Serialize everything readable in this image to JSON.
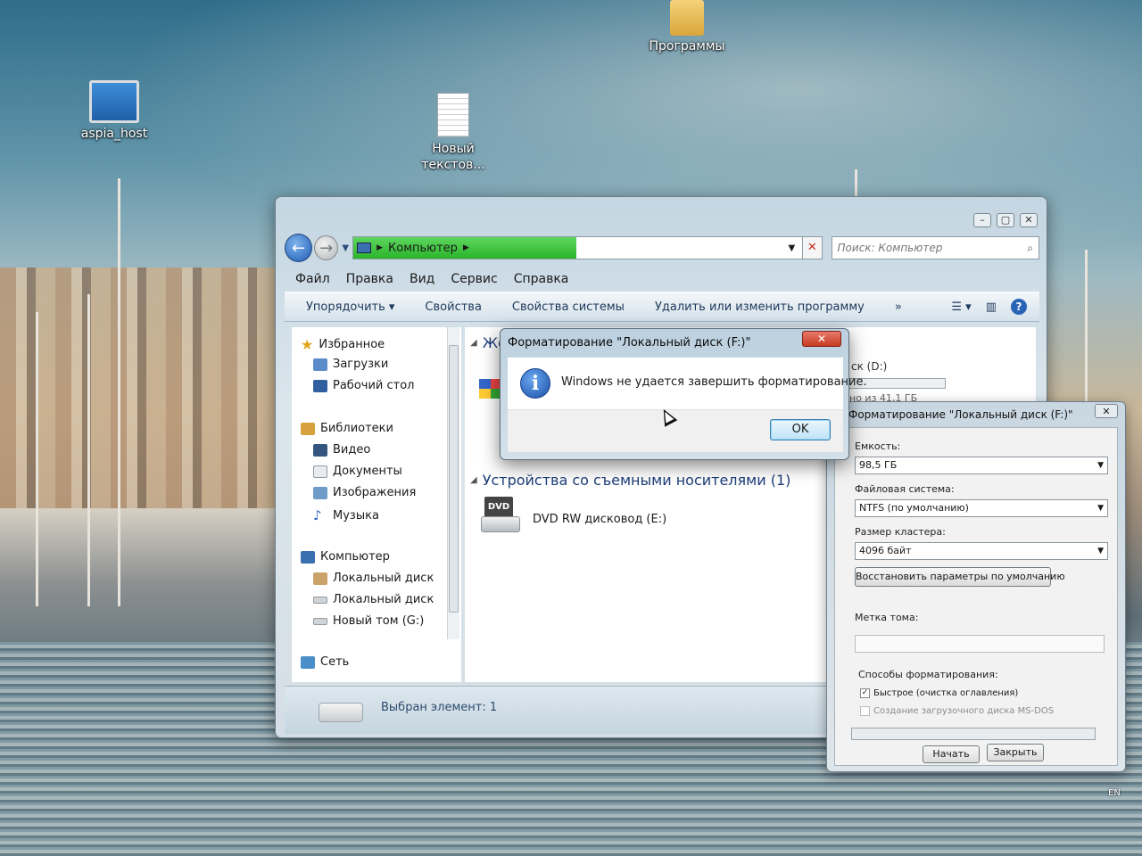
{
  "desktop": {
    "icons": [
      {
        "label": "Программы"
      },
      {
        "label": "aspia_host"
      },
      {
        "label": "Новый текстов..."
      }
    ],
    "tray_lang": "EN"
  },
  "explorer": {
    "address_crumbs": [
      "Компьютер"
    ],
    "search_placeholder": "Поиск: Компьютер",
    "menu": [
      "Файл",
      "Правка",
      "Вид",
      "Сервис",
      "Справка"
    ],
    "commands": [
      "Упорядочить ▾",
      "Свойства",
      "Свойства системы",
      "Удалить или изменить программу",
      "»"
    ],
    "nav": {
      "favorites": "Избранное",
      "favorites_items": [
        "Загрузки",
        "Рабочий стол"
      ],
      "libraries": "Библиотеки",
      "libraries_items": [
        "Видео",
        "Документы",
        "Изображения",
        "Музыка"
      ],
      "computer": "Компьютер",
      "computer_items": [
        "Локальный диск",
        "Локальный диск",
        "Новый том (G:)"
      ],
      "network": "Сеть"
    },
    "groups": {
      "hard_disks_partial": "Же",
      "removable": "Устройства со съемными носителями (1)"
    },
    "devices": [
      {
        "label": "DVD RW дисковод (E:)",
        "icon": "dvd-drive-icon"
      }
    ],
    "partial_drive_label": "ск (D:)",
    "partial_drive_free": "но из 41,1 ГБ",
    "status": "Выбран элемент: 1"
  },
  "format_dialog": {
    "title": "Форматирование \"Локальный диск (F:)\"",
    "capacity_label": "Емкость:",
    "capacity_value": "98,5 ГБ",
    "fs_label": "Файловая система:",
    "fs_value": "NTFS (по умолчанию)",
    "cluster_label": "Размер кластера:",
    "cluster_value": "4096 байт",
    "restore_button": "Восстановить параметры по умолчанию",
    "volume_label": "Метка тома:",
    "volume_value": "",
    "options_label": "Способы форматирования:",
    "quick_label": "Быстрое (очистка оглавления)",
    "quick_checked": true,
    "msdos_label": "Создание загрузочного диска MS-DOS",
    "start_button": "Начать",
    "close_button": "Закрыть"
  },
  "message_box": {
    "title": "Форматирование \"Локальный диск (F:)\"",
    "text": "Windows не удается завершить форматирование.",
    "ok": "OK",
    "close": "✕"
  }
}
